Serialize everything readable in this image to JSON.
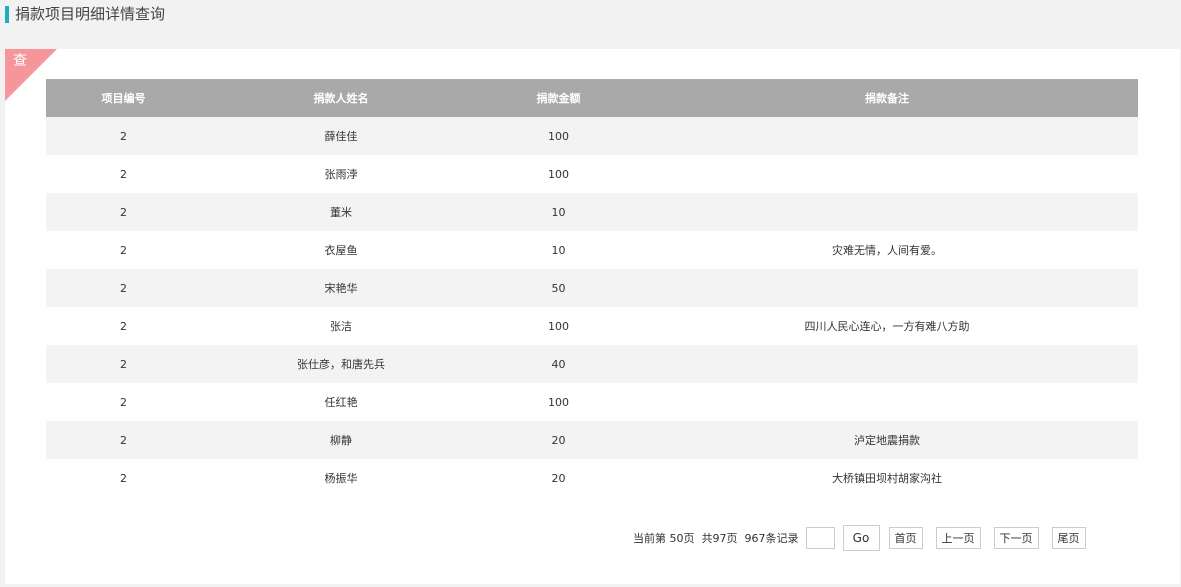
{
  "page": {
    "title": "捐款项目明细详情查询"
  },
  "badge": {
    "label": "查"
  },
  "table": {
    "headers": [
      "项目编号",
      "捐款人姓名",
      "捐款金额",
      "捐款备注"
    ],
    "rows": [
      [
        "2",
        "薛佳佳",
        "100",
        ""
      ],
      [
        "2",
        "张雨浡",
        "100",
        ""
      ],
      [
        "2",
        "董米",
        "10",
        ""
      ],
      [
        "2",
        "衣屋鱼",
        "10",
        "灾难无情，人间有爱。"
      ],
      [
        "2",
        "宋艳华",
        "50",
        ""
      ],
      [
        "2",
        "张洁",
        "100",
        "四川人民心连心，一方有难八方助"
      ],
      [
        "2",
        "张仕彦，和唐先兵",
        "40",
        ""
      ],
      [
        "2",
        "任红艳",
        "100",
        ""
      ],
      [
        "2",
        "柳静",
        "20",
        "泸定地震捐款"
      ],
      [
        "2",
        "杨振华",
        "20",
        "大桥镇田坝村胡家沟社"
      ]
    ]
  },
  "pager": {
    "current_page": "当前第 50页",
    "total_pages": "共97页",
    "total_records": "967条记录",
    "page_input_value": "",
    "go_label": "Go",
    "first_label": "首页",
    "prev_label": "上一页",
    "next_label": "下一页",
    "last_label": "尾页"
  },
  "colors": {
    "accent": "#1ab0c0",
    "corner": "#f6959a",
    "header_bg": "#a9a9a9"
  }
}
